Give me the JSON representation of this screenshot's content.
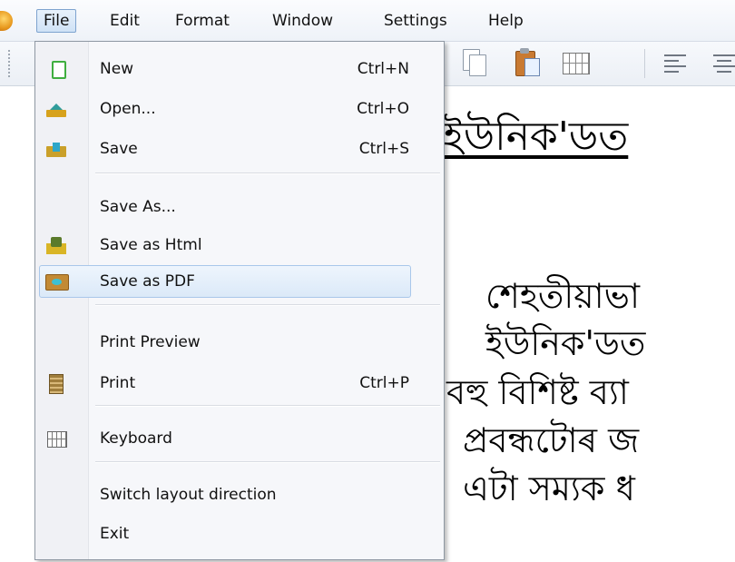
{
  "menubar": {
    "items": [
      {
        "label": "File",
        "active": true
      },
      {
        "label": "Edit"
      },
      {
        "label": "Format"
      },
      {
        "label": "Window"
      },
      {
        "label": "Settings"
      },
      {
        "label": "Help"
      }
    ]
  },
  "file_menu": {
    "items": [
      {
        "label": "New",
        "shortcut": "Ctrl+N",
        "icon": "new-file-icon"
      },
      {
        "label": "Open...",
        "shortcut": "Ctrl+O",
        "icon": "open-folder-icon"
      },
      {
        "label": "Save",
        "shortcut": "Ctrl+S",
        "icon": "save-icon"
      },
      {
        "label": "Save As..."
      },
      {
        "label": "Save as Html",
        "icon": "save-html-icon"
      },
      {
        "label": "Save as PDF",
        "icon": "save-pdf-icon",
        "highlighted": true
      },
      {
        "label": "Print Preview"
      },
      {
        "label": "Print",
        "shortcut": "Ctrl+P",
        "icon": "print-icon"
      },
      {
        "label": "Keyboard",
        "icon": "keyboard-icon"
      },
      {
        "label": "Switch layout direction"
      },
      {
        "label": "Exit"
      }
    ]
  },
  "document": {
    "title": "ইউনিক'ডত",
    "lines": [
      "শেহতীয়াভা",
      "ইউনিক'ডত",
      "বহু বিশিষ্ট ব্যা",
      "প্ৰবন্ধটোৰ জ",
      "এটা সম্যক ধ"
    ]
  },
  "colors": {
    "highlight_bg": "#dbe9f8",
    "highlight_border": "#a9c7ea",
    "menu_bg": "#f6f7fa"
  }
}
